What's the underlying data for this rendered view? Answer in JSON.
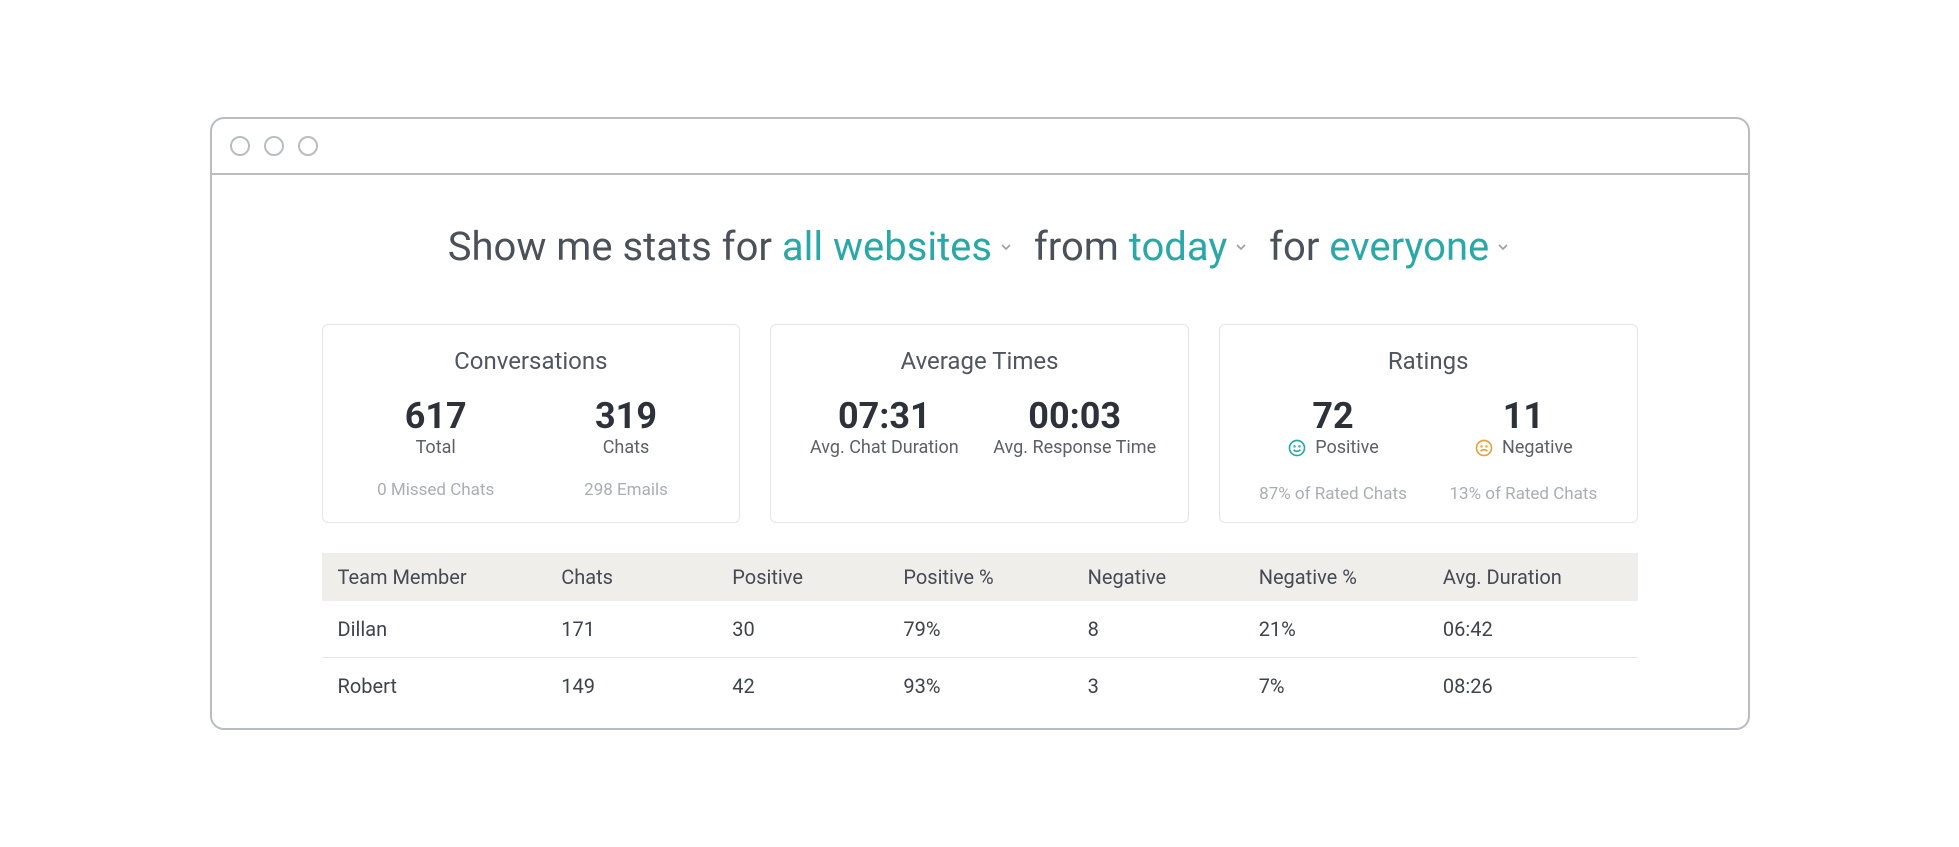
{
  "filters": {
    "prefix": "Show me stats for",
    "websites_value": "all websites",
    "from_label": "from",
    "date_value": "today",
    "for_label": "for",
    "people_value": "everyone"
  },
  "cards": {
    "conversations": {
      "title": "Conversations",
      "total_value": "617",
      "total_label": "Total",
      "chats_value": "319",
      "chats_label": "Chats",
      "missed": "0 Missed Chats",
      "emails": "298 Emails"
    },
    "avg_times": {
      "title": "Average Times",
      "chat_dur_value": "07:31",
      "chat_dur_label": "Avg. Chat Duration",
      "resp_time_value": "00:03",
      "resp_time_label": "Avg. Response Time"
    },
    "ratings": {
      "title": "Ratings",
      "positive_value": "72",
      "positive_label": "Positive",
      "negative_value": "11",
      "negative_label": "Negative",
      "positive_pct": "87% of Rated Chats",
      "negative_pct": "13% of Rated Chats"
    }
  },
  "table": {
    "headers": {
      "member": "Team Member",
      "chats": "Chats",
      "positive": "Positive",
      "positive_pct": "Positive %",
      "negative": "Negative",
      "negative_pct": "Negative %",
      "avg_dur": "Avg. Duration"
    },
    "rows": [
      {
        "member": "Dillan",
        "chats": "171",
        "positive": "30",
        "positive_pct": "79%",
        "negative": "8",
        "negative_pct": "21%",
        "avg_dur": "06:42"
      },
      {
        "member": "Robert",
        "chats": "149",
        "positive": "42",
        "positive_pct": "93%",
        "negative": "3",
        "negative_pct": "7%",
        "avg_dur": "08:26"
      }
    ]
  },
  "colors": {
    "accent": "#2aa8a8",
    "positive_icon": "#2aa8a8",
    "negative_icon": "#e6a23c"
  }
}
